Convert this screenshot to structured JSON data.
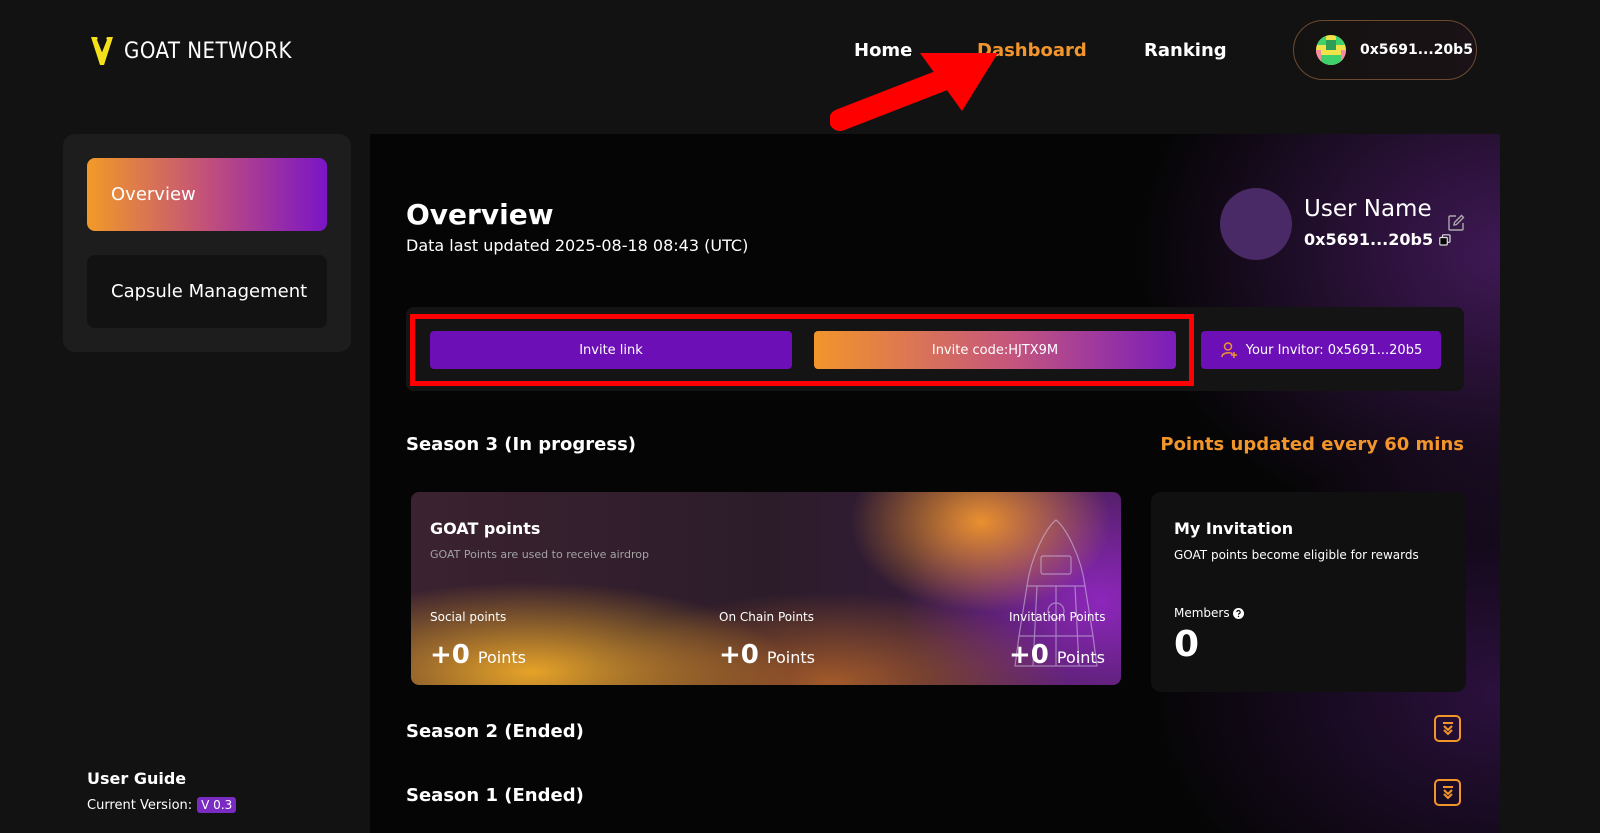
{
  "header": {
    "logo_text": "GOAT NETWORK",
    "nav": [
      {
        "label": "Home",
        "active": false
      },
      {
        "label": "Dashboard",
        "active": true
      },
      {
        "label": "Ranking",
        "active": false
      }
    ],
    "wallet_address": "0x5691...20b5"
  },
  "sidebar": {
    "items": [
      {
        "label": "Overview",
        "active": true
      },
      {
        "label": "Capsule Management",
        "active": false
      }
    ],
    "user_guide": "User Guide",
    "version_label": "Current Version:",
    "version": "V 0.3"
  },
  "overview": {
    "title": "Overview",
    "updated": "Data last updated 2025-08-18 08:43 (UTC)",
    "user_name": "User Name",
    "user_address": "0x5691...20b5"
  },
  "invite": {
    "link_label": "Invite link",
    "code_label": "Invite code:HJTX9M",
    "invitor_label": "Your Invitor: 0x5691...20b5"
  },
  "season3": {
    "title": "Season 3 (In progress)",
    "points_note": "Points updated every 60 mins",
    "goat_card": {
      "title": "GOAT points",
      "subtitle": "GOAT Points are used to receive airdrop",
      "social_label": "Social points",
      "social_value": "+0",
      "onchain_label": "On Chain Points",
      "onchain_value": "+0",
      "invitation_label": "Invitation Points",
      "invitation_value": "+0",
      "unit": "Points"
    },
    "invitation_card": {
      "title": "My Invitation",
      "subtitle": "GOAT points become eligible for rewards",
      "members_label": "Members",
      "members_count": "0"
    }
  },
  "season2": {
    "title": "Season 2 (Ended)"
  },
  "season1": {
    "title": "Season 1 (Ended)"
  },
  "colors": {
    "accent_orange": "#f2952b",
    "accent_purple": "#6c0fb7",
    "annotation_red": "#ff0000"
  }
}
